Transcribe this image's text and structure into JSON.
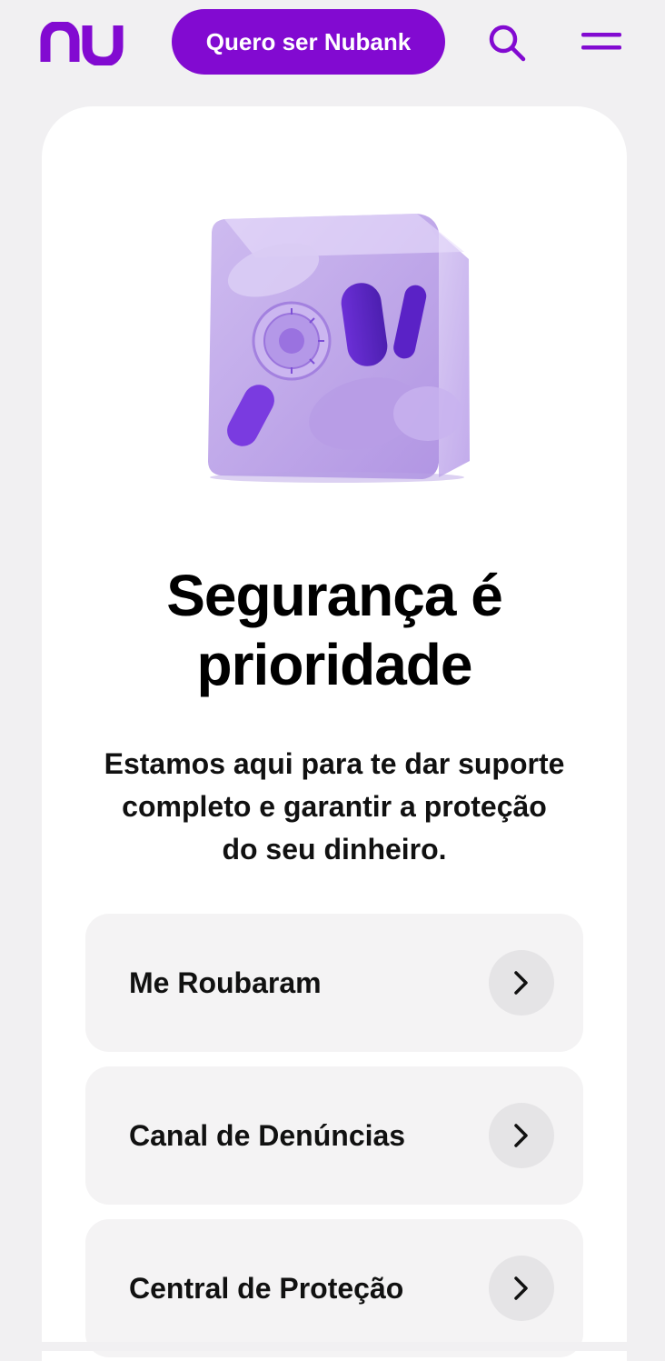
{
  "header": {
    "logo_icon": "nu-logo-icon",
    "cta_label": "Quero ser Nubank",
    "search_icon": "search-icon",
    "menu_icon": "hamburger-menu-icon"
  },
  "hero": {
    "illustration_icon": "safe-cube-illustration",
    "title_line1": "Segurança é",
    "title_line2": "prioridade",
    "description_line1": "Estamos aqui para te dar suporte",
    "description_line2": "completo e garantir a proteção",
    "description_line3": "do seu dinheiro."
  },
  "links": [
    {
      "label": "Me Roubaram",
      "icon": "chevron-right-icon"
    },
    {
      "label": "Canal de Denúncias",
      "icon": "chevron-right-icon"
    },
    {
      "label": "Central de Proteção",
      "icon": "chevron-right-icon"
    }
  ],
  "colors": {
    "brand": "#820ad1",
    "page_background": "#f1f0f2",
    "card_background": "#ffffff",
    "item_background": "#f4f3f4",
    "chevron_background": "#e5e4e6"
  }
}
